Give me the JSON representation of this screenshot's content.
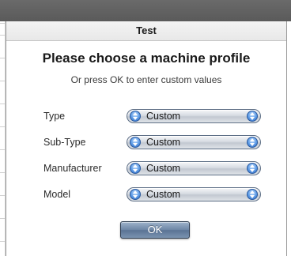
{
  "dialog": {
    "title": "Test",
    "heading": "Please choose a machine profile",
    "subheading": "Or press OK to enter custom values",
    "fields": [
      {
        "label": "Type",
        "value": "Custom"
      },
      {
        "label": "Sub-Type",
        "value": "Custom"
      },
      {
        "label": "Manufacturer",
        "value": "Custom"
      },
      {
        "label": "Model",
        "value": "Custom"
      }
    ],
    "ok_label": "OK"
  },
  "icons": {
    "popup_arrows": "up-down-arrows-icon"
  }
}
